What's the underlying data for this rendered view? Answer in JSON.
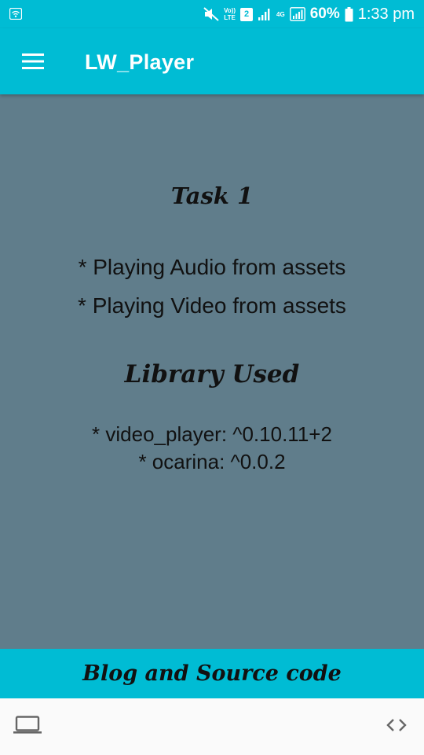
{
  "status_bar": {
    "volte_top": "Vo))",
    "volte_bottom": "LTE",
    "sim": "2",
    "network_type": "4G",
    "battery_percent": "60%",
    "time": "1:33 pm"
  },
  "app_bar": {
    "title": "LW_Player",
    "menu_icon": "menu-icon"
  },
  "content": {
    "task_heading": "Task 1",
    "tasks": [
      "* Playing Audio from assets",
      "* Playing Video from assets"
    ],
    "library_heading": "Library Used",
    "libraries": [
      "* video_player: ^0.10.11+2",
      "* ocarina: ^0.0.2"
    ]
  },
  "footer": {
    "link_label": "Blog and Source code"
  },
  "bottom_nav": {
    "left_icon": "laptop-icon",
    "right_icon": "code-icon"
  },
  "colors": {
    "accent": "#00BCD4",
    "content_background": "#607D8B",
    "text": "#111111",
    "nav_background": "#FAFAFA"
  }
}
